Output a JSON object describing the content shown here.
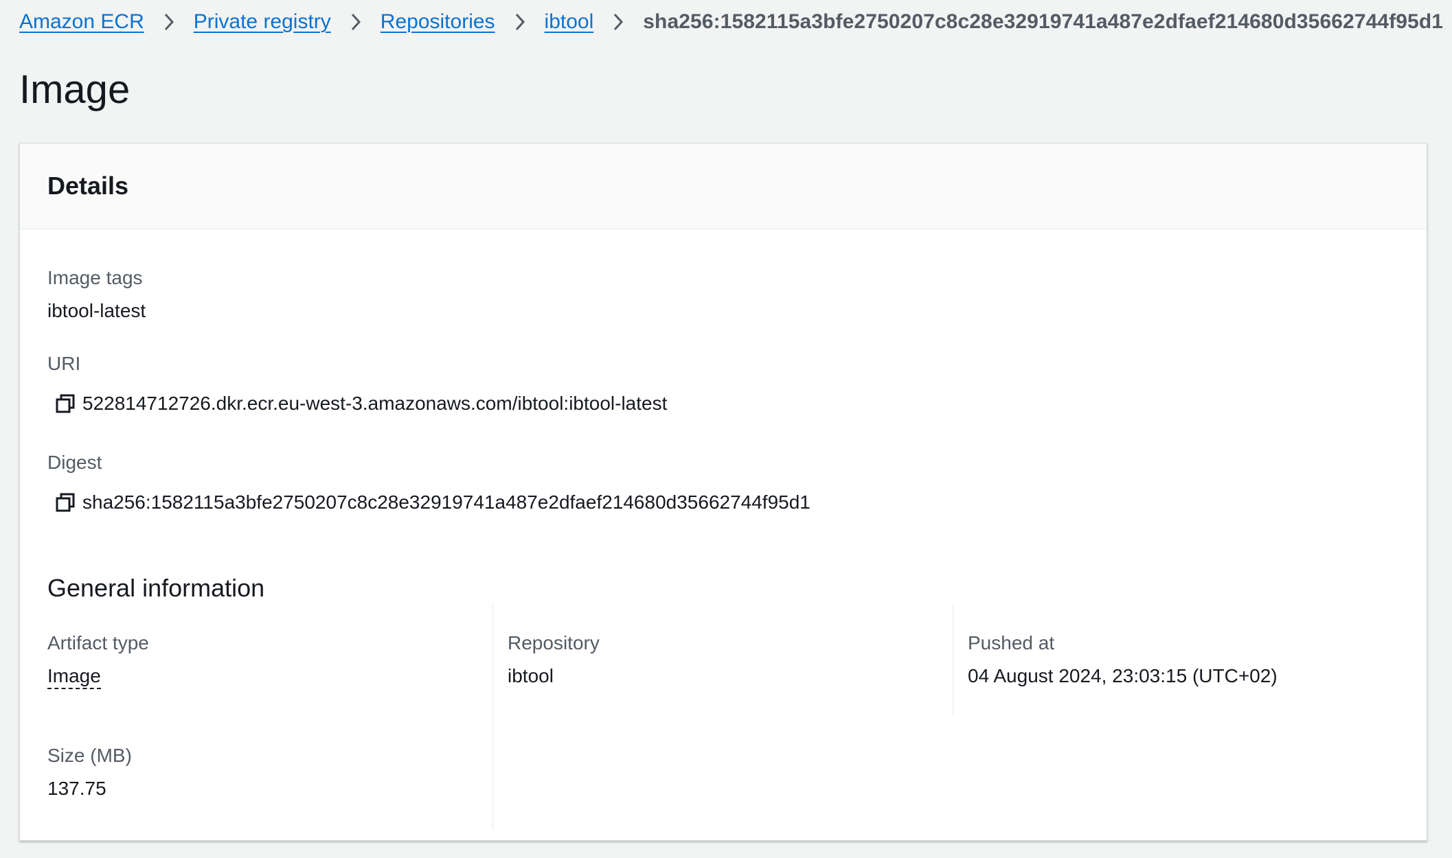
{
  "breadcrumb": {
    "items": [
      "Amazon ECR",
      "Private registry",
      "Repositories",
      "ibtool"
    ],
    "current": "sha256:1582115a3bfe2750207c8c28e32919741a487e2dfaef214680d35662744f95d1"
  },
  "page": {
    "title": "Image"
  },
  "details": {
    "title": "Details",
    "image_tags": {
      "label": "Image tags",
      "value": "ibtool-latest"
    },
    "uri": {
      "label": "URI",
      "value": "522814712726.dkr.ecr.eu-west-3.amazonaws.com/ibtool:ibtool-latest"
    },
    "digest": {
      "label": "Digest",
      "value": "sha256:1582115a3bfe2750207c8c28e32919741a487e2dfaef214680d35662744f95d1"
    }
  },
  "general": {
    "title": "General information",
    "artifact_type": {
      "label": "Artifact type",
      "value": "Image"
    },
    "repository": {
      "label": "Repository",
      "value": "ibtool"
    },
    "pushed_at": {
      "label": "Pushed at",
      "value": "04 August 2024, 23:03:15 (UTC+02)"
    },
    "size": {
      "label": "Size (MB)",
      "value": "137.75"
    }
  },
  "icons": {
    "chevron": "chevron-right-icon",
    "copy": "copy-icon"
  },
  "colors": {
    "link": "#0972d3",
    "text": "#16191f",
    "muted": "#545b64",
    "background": "#f2f3f3"
  }
}
